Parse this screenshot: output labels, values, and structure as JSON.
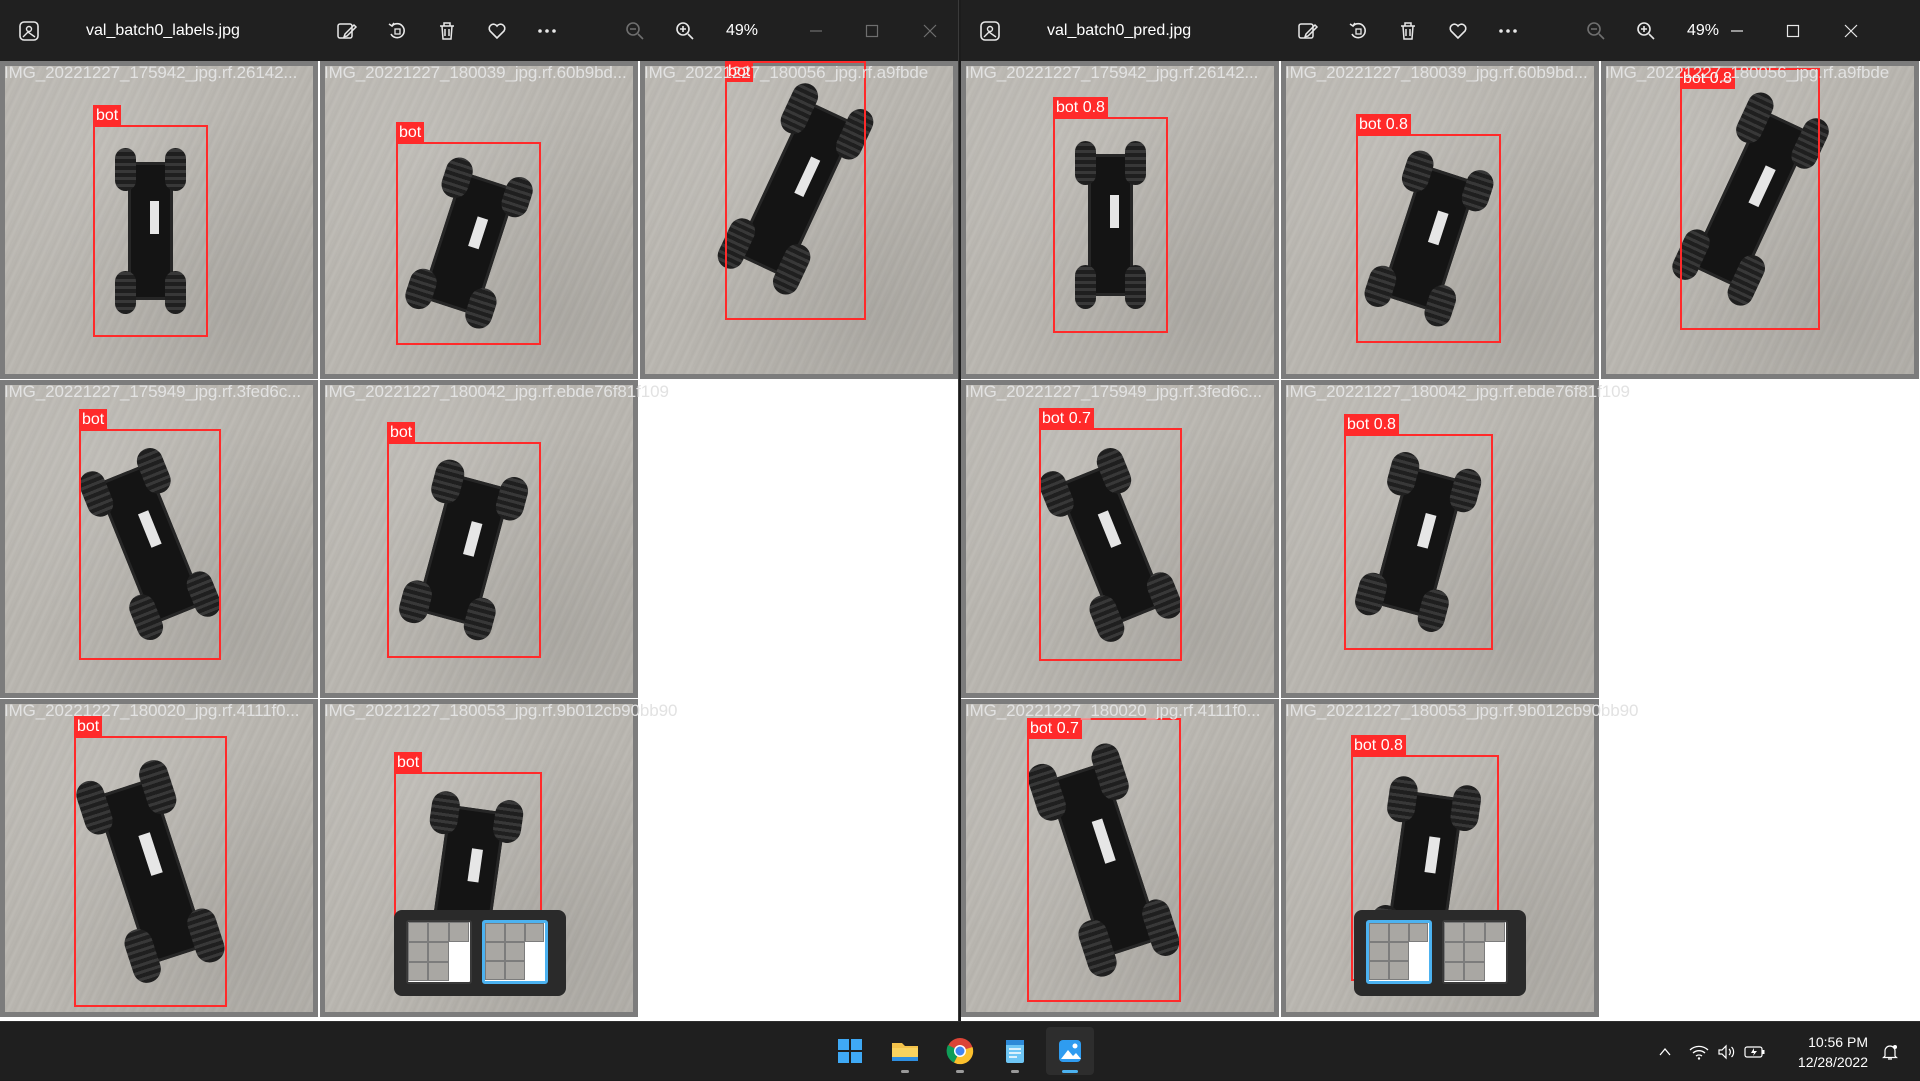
{
  "windows": [
    {
      "id": "left",
      "title": "val_batch0_labels.jpg",
      "zoom": "49%",
      "tiles": [
        {
          "filename": "IMG_20221227_175942_jpg.rf.26142...",
          "label": "bot"
        },
        {
          "filename": "IMG_20221227_180039_jpg.rf.60b9bd...",
          "label": "bot"
        },
        {
          "filename": "IMG_20221227_180056_jpg.rf.a9fbde",
          "label": "bot"
        },
        {
          "filename": "IMG_20221227_175949_jpg.rf.3fed6c...",
          "label": "bot"
        },
        {
          "filename": "IMG_20221227_180042_jpg.rf.ebde76f81f109",
          "label": "bot"
        },
        {
          "filename": "IMG_20221227_180020_jpg.rf.4111f0...",
          "label": "bot"
        },
        {
          "filename": "IMG_20221227_180053_jpg.rf.9b012cb90bb90",
          "label": "bot"
        }
      ]
    },
    {
      "id": "right",
      "title": "val_batch0_pred.jpg",
      "zoom": "49%",
      "tiles": [
        {
          "filename": "IMG_20221227_175942_jpg.rf.26142...",
          "label": "bot 0.8"
        },
        {
          "filename": "IMG_20221227_180039_jpg.rf.60b9bd...",
          "label": "bot 0.8"
        },
        {
          "filename": "IMG_20221227_180056_jpg.rf.a9fbde",
          "label": "bot 0.8"
        },
        {
          "filename": "IMG_20221227_175949_jpg.rf.3fed6c...",
          "label": "bot 0.7"
        },
        {
          "filename": "IMG_20221227_180042_jpg.rf.ebde76f81f109",
          "label": "bot 0.8"
        },
        {
          "filename": "IMG_20221227_180020_jpg.rf.4111f0...",
          "label": "bot 0.7"
        },
        {
          "filename": "IMG_20221227_180053_jpg.rf.9b012cb90bb90",
          "label": "bot 0.8"
        }
      ]
    }
  ],
  "toolbar_icons": [
    "app-photos-icon",
    "edit-image-icon",
    "rotate-icon",
    "delete-icon",
    "favorite-heart-icon",
    "more-icon",
    "zoom-out-icon",
    "zoom-in-icon",
    "minimize-icon",
    "maximize-icon",
    "close-icon"
  ],
  "taskbar": {
    "apps": [
      "start-windows-icon",
      "file-explorer-icon",
      "chrome-icon",
      "notepad-icon",
      "photos-icon"
    ],
    "time": "10:56 PM",
    "date": "12/28/2022"
  },
  "colors": {
    "bbox": "#ff2a2a",
    "titlebar": "#202020",
    "taskbar": "#1f1f1f",
    "accent": "#4cb2f0"
  }
}
